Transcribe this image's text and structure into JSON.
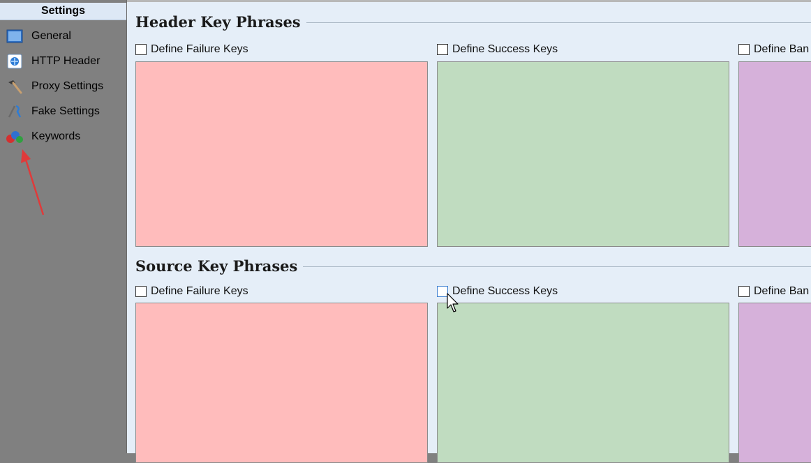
{
  "sidebar": {
    "title": "Settings",
    "items": [
      {
        "label": "General",
        "icon": "window-icon"
      },
      {
        "label": "HTTP Header",
        "icon": "http-header-icon"
      },
      {
        "label": "Proxy Settings",
        "icon": "hammer-icon"
      },
      {
        "label": "Fake Settings",
        "icon": "tools-icon"
      },
      {
        "label": "Keywords",
        "icon": "abc-keywords-icon"
      }
    ]
  },
  "header_section": {
    "title": "Header Key Phrases",
    "failure_label": "Define Failure Keys",
    "success_label": "Define Success Keys",
    "ban_label": "Define Ban"
  },
  "source_section": {
    "title": "Source Key Phrases",
    "failure_label": "Define Failure Keys",
    "success_label": "Define Success Keys",
    "ban_label": "Define Ban"
  },
  "colors": {
    "failure": "#ffbcbc",
    "success": "#c0dcc0",
    "ban": "#d6b1da",
    "sidebar": "#808080",
    "content": "#e5eef8",
    "annotation_arrow": "#e03a3a"
  }
}
